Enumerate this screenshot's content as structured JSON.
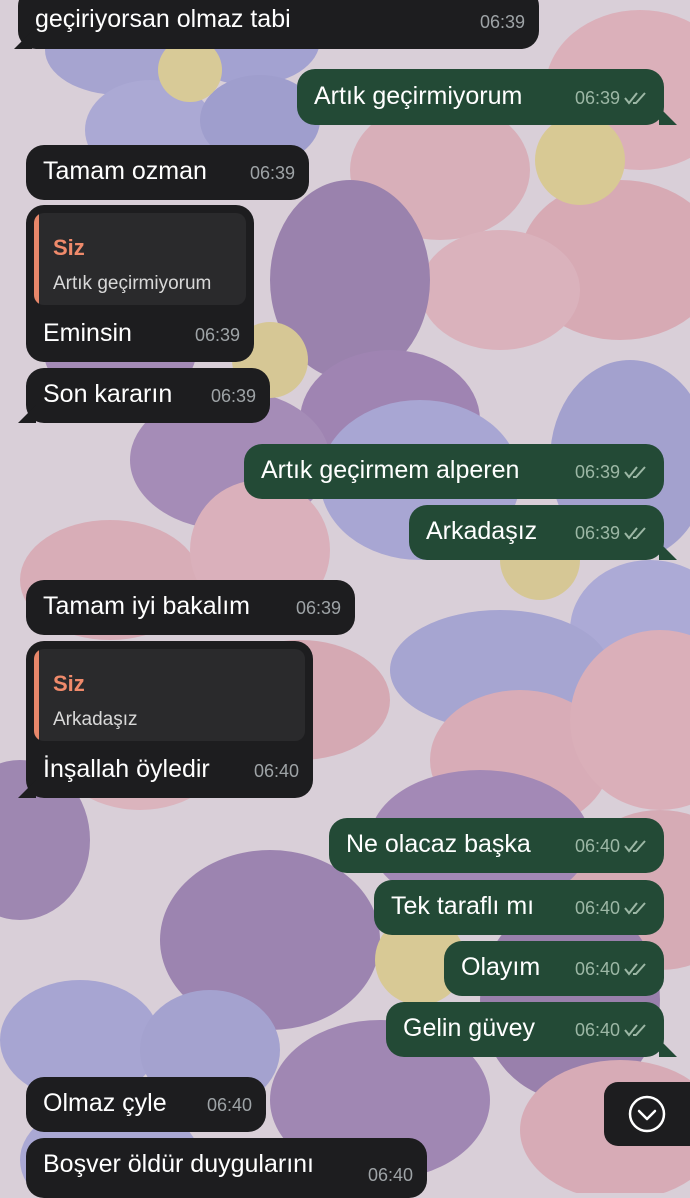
{
  "chat": {
    "messages": [
      {
        "dir": "in",
        "text": "geçiriyorsan olmaz tabi",
        "time": "06:39"
      },
      {
        "dir": "out",
        "text": "Artık geçirmiyorum",
        "time": "06:39"
      },
      {
        "dir": "in",
        "text": "Tamam ozman",
        "time": "06:39"
      },
      {
        "dir": "in",
        "text": "Eminsin",
        "time": "06:39",
        "reply": {
          "name": "Siz",
          "text": "Artık geçirmiyorum"
        }
      },
      {
        "dir": "in",
        "text": "Son kararın",
        "time": "06:39"
      },
      {
        "dir": "out",
        "text": "Artık geçirmem alperen",
        "time": "06:39"
      },
      {
        "dir": "out",
        "text": "Arkadaşız",
        "time": "06:39"
      },
      {
        "dir": "in",
        "text": "Tamam iyi bakalım",
        "time": "06:39"
      },
      {
        "dir": "in",
        "text": "İnşallah öyledir",
        "time": "06:40",
        "reply": {
          "name": "Siz",
          "text": "Arkadaşız"
        }
      },
      {
        "dir": "out",
        "text": "Ne olacaz başka",
        "time": "06:40"
      },
      {
        "dir": "out",
        "text": "Tek taraflı mı",
        "time": "06:40"
      },
      {
        "dir": "out",
        "text": "Olayım",
        "time": "06:40"
      },
      {
        "dir": "out",
        "text": "Gelin güvey",
        "time": "06:40"
      },
      {
        "dir": "in",
        "text": "Olmaz çyle",
        "time": "06:40"
      },
      {
        "dir": "in",
        "text": "Boşver öldür duygularını",
        "time": "06:40"
      }
    ]
  },
  "colors": {
    "incoming_bubble": "#1d1d1f",
    "outgoing_bubble": "#234a36",
    "reply_accent": "#e8876a",
    "wallpaper": "#d9cfd8"
  },
  "icons": {
    "read_receipt": "double-check-icon",
    "scroll_down": "chevron-down-circle-icon"
  }
}
